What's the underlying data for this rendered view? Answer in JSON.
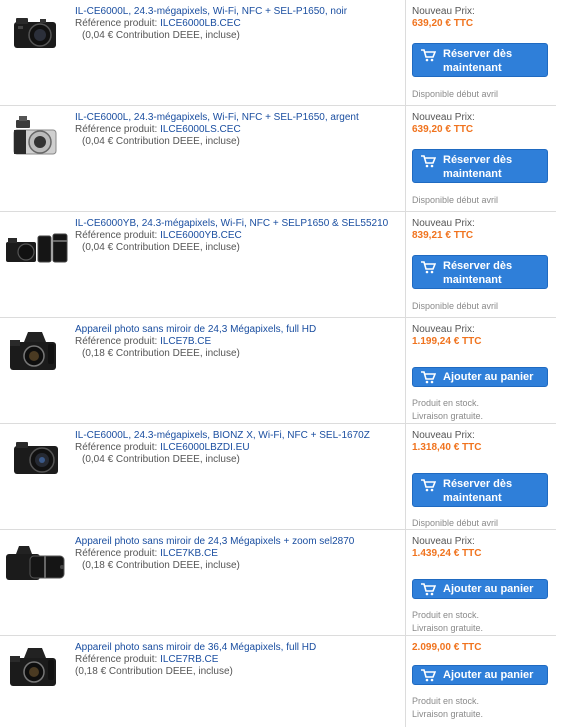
{
  "colors": {
    "link": "#1a4ea0",
    "price": "#f0731e",
    "button": "#2f7fd9",
    "note": "#8a8a8a"
  },
  "products": [
    {
      "title": "IL-CE6000L, 24.3-mégapixels, Wi-Fi, NFC + SEL-P1650, noir",
      "ref_label": "Référence produit:",
      "ref": "ILCE6000LB.CEC",
      "deee": "(0,04 € Contribution DEEE, incluse)",
      "new_price_label": "Nouveau Prix:",
      "price": "639,20 € TTC",
      "button_label": "Réserver dès maintenant",
      "button_icon": "cart-icon",
      "availability": [
        "Disponible début avril"
      ],
      "image": "camera-black-kit-icon"
    },
    {
      "title": "IL-CE6000L, 24.3-mégapixels, Wi-Fi, NFC + SEL-P1650, argent",
      "ref_label": "Référence produit:",
      "ref": "ILCE6000LS.CEC",
      "deee": "(0,04 € Contribution DEEE, incluse)",
      "new_price_label": "Nouveau Prix:",
      "price": "639,20 € TTC",
      "button_label": "Réserver dès maintenant",
      "button_icon": "cart-icon",
      "availability": [
        "Disponible début avril"
      ],
      "image": "camera-silver-kit-icon"
    },
    {
      "title": "IL-CE6000YB, 24.3-mégapixels, Wi-Fi, NFC + SELP1650 & SEL55210",
      "ref_label": "Référence produit:",
      "ref": "ILCE6000YB.CEC",
      "deee": "(0,04 € Contribution DEEE, incluse)",
      "new_price_label": "Nouveau Prix:",
      "price": "839,21 € TTC",
      "button_label": "Réserver dès maintenant",
      "button_icon": "cart-icon",
      "availability": [
        "Disponible début avril"
      ],
      "image": "camera-two-lens-kit-icon"
    },
    {
      "title": "Appareil photo sans miroir de 24,3 Mégapixels, full HD",
      "ref_label": "Référence produit:",
      "ref": "ILCE7B.CE",
      "deee": "(0,18 € Contribution DEEE, incluse)",
      "new_price_label": "Nouveau Prix:",
      "price": "1.199,24 € TTC",
      "button_label": "Ajouter au panier",
      "button_icon": "cart-icon",
      "availability": [
        "Produit en stock.",
        "Livraison gratuite."
      ],
      "image": "camera-body-icon"
    },
    {
      "title": "IL-CE6000L, 24.3-mégapixels, BIONZ X, Wi-Fi, NFC + SEL-1670Z",
      "ref_label": "Référence produit:",
      "ref": "ILCE6000LBZDI.EU",
      "deee": "(0,04 € Contribution DEEE, incluse)",
      "new_price_label": "Nouveau Prix:",
      "price": "1.318,40 € TTC",
      "button_label": "Réserver dès maintenant",
      "button_icon": "cart-icon",
      "availability": [
        "Disponible début avril"
      ],
      "image": "camera-black-zeiss-kit-icon"
    },
    {
      "title": "Appareil photo sans miroir de 24,3 Mégapixels + zoom sel2870",
      "ref_label": "Référence produit:",
      "ref": "ILCE7KB.CE",
      "deee": "(0,18 € Contribution DEEE, incluse)",
      "new_price_label": "Nouveau Prix:",
      "price": "1.439,24 € TTC",
      "button_label": "Ajouter au panier",
      "button_icon": "cart-icon",
      "availability": [
        "Produit en stock.",
        "Livraison gratuite."
      ],
      "image": "camera-zoom-kit-icon"
    },
    {
      "title": "Appareil photo sans miroir de 36,4 Mégapixels, full HD",
      "ref_label": "Référence produit:",
      "ref": "ILCE7RB.CE",
      "deee": "(0,18 € Contribution DEEE, incluse)",
      "new_price_label": "",
      "price": "2.099,00 € TTC",
      "button_label": "Ajouter au panier",
      "button_icon": "cart-icon",
      "availability": [
        "Produit en stock.",
        "Livraison gratuite."
      ],
      "image": "camera-body-icon"
    }
  ]
}
